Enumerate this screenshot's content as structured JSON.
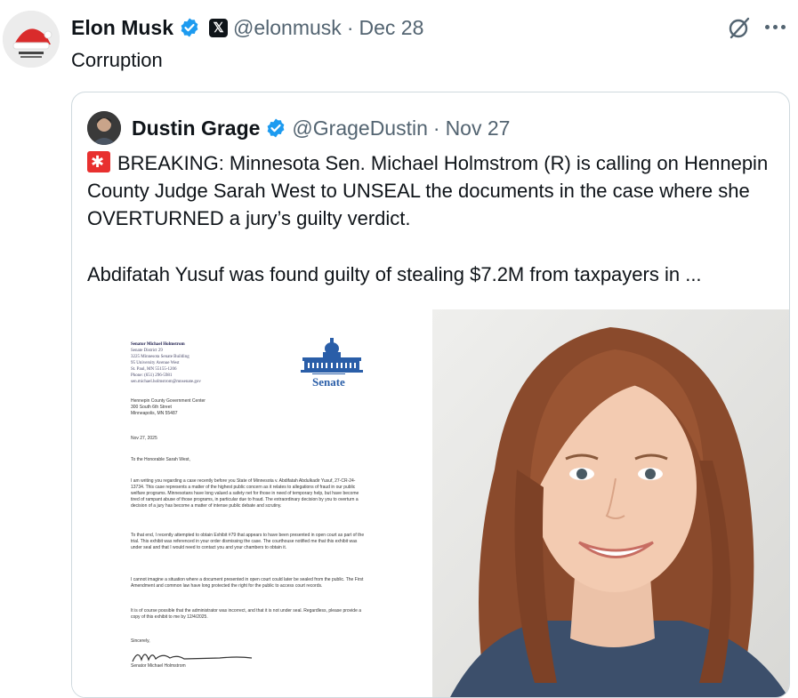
{
  "tweet": {
    "author_name": "Elon Musk",
    "author_handle": "@elonmusk",
    "separator": "·",
    "date": "Dec 28",
    "text": "Corruption"
  },
  "quote": {
    "author_name": "Dustin Grage",
    "author_handle": "@GrageDustin",
    "separator": "·",
    "date": "Nov 27",
    "line1": "BREAKING: Minnesota Sen. Michael Holmstrom (R) is calling on Hennepin County Judge Sarah West to UNSEAL the documents in the case where she OVERTURNED a jury’s guilty verdict.",
    "line2": "Abdifatah Yusuf was found guilty of stealing $7.2M from taxpayers in ..."
  },
  "letter": {
    "sender_name": "Senator Michael Holmstrom",
    "sender_lines": [
      "Senate District 29",
      "3225 Minnesota Senate Building",
      "95 University Avenue West",
      "St. Paul, MN 55155-1206",
      "Phone: (651) 296-5981",
      "sen.michael.holmstrom@mnsenate.gov"
    ],
    "seal_label": "Senate",
    "recipient_lines": [
      "Hennepin County Government Center",
      "300 South 6th Street",
      "Minneapolis, MN 55487"
    ],
    "date": "Nov 27, 2025",
    "salutation": "To the Honorable Sarah West,",
    "para1": "I am writing you regarding a case recently before you State of Minnesota v. Abdifatah Abdulkadir Yusuf, 27-CR-24-13734. This case represents a matter of the highest public concern as it relates to allegations of fraud in our public welfare programs. Minnesotans have long valued a safety net for those in need of temporary help, but have become tired of rampant abuse of those programs, in particular due to fraud. The extraordinary decision by you to overturn a decision of a jury has become a matter of intense public debate and scrutiny.",
    "para2": "To that end, I recently attempted to obtain Exhibit #79 that appears to have been presented in open court as part of the trial. This exhibit was referenced in your order dismissing the case. The courthouse notified me that this exhibit was under seal and that I would need to contact you and your chambers to obtain it.",
    "para3": "I cannot imagine a situation where a document presented in open court could later be sealed from the public. The First Amendment and common law have long protected the right for the public to access court records.",
    "para4": "It is of course possible that the administrator was incorrect, and that it is not under seal. Regardless, please provide a copy of this exhibit to me by 12/4/2025.",
    "closing": "Sincerely,",
    "signature": "Senator Michael Holmstrom"
  },
  "colors": {
    "verified": "#1d9bf0",
    "secondary_text": "#536471",
    "border": "#cfd9de",
    "senate_blue": "#2a5ea8"
  }
}
